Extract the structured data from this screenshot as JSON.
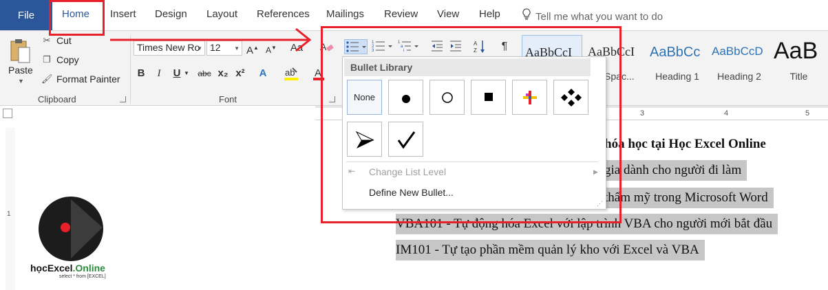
{
  "tabs": [
    {
      "label": "File"
    },
    {
      "label": "Home"
    },
    {
      "label": "Insert"
    },
    {
      "label": "Design"
    },
    {
      "label": "Layout"
    },
    {
      "label": "References"
    },
    {
      "label": "Mailings"
    },
    {
      "label": "Review"
    },
    {
      "label": "View"
    },
    {
      "label": "Help"
    }
  ],
  "tell_me": {
    "text": "Tell me what you want to do",
    "icon": "lightbulb-icon"
  },
  "clipboard": {
    "paste_label": "Paste",
    "cut_label": "Cut",
    "copy_label": "Copy",
    "format_painter_label": "Format Painter",
    "group_label": "Clipboard"
  },
  "font": {
    "family": "Times New Ro",
    "size": "12",
    "grow_label": "A",
    "shrink_label": "A",
    "case_label": "Aa",
    "bold_label": "B",
    "italic_label": "I",
    "underline_label": "U",
    "strike_label": "abc",
    "subscript_label": "x₂",
    "superscript_label": "x²",
    "group_label": "Font"
  },
  "styles": [
    {
      "sample": "AaBbCcI",
      "name": ""
    },
    {
      "sample": "AaBbCcI",
      "name": "o Spac..."
    },
    {
      "sample": "AaBbCc",
      "name": "Heading 1"
    },
    {
      "sample": "AaBbCcD",
      "name": "Heading 2"
    },
    {
      "sample": "AaB",
      "name": "Title"
    }
  ],
  "ruler": {
    "marks": [
      "3",
      "4",
      "5"
    ],
    "vertical_mark": "1"
  },
  "bullet_menu": {
    "title": "Bullet Library",
    "none_label": "None",
    "items": [
      {
        "name": "filled-circle"
      },
      {
        "name": "hollow-circle"
      },
      {
        "name": "filled-square"
      },
      {
        "name": "four-color-cross"
      },
      {
        "name": "four-diamonds"
      },
      {
        "name": "arrowhead"
      },
      {
        "name": "checkmark"
      }
    ],
    "change_level_label": "Change List Level",
    "define_new_label": "Define New Bullet..."
  },
  "document": {
    "lines": [
      "hóa học tại Học Excel Online",
      "gia dành cho người đi làm",
      "thẩm mỹ trong Microsoft Word",
      "VBA101 - Tự động hóa Excel với lập trình VBA cho người mới bắt đầu",
      "IM101 - Tự tạo phần mềm quản lý kho với Excel và VBA"
    ]
  },
  "logo": {
    "text_left": "họcExcel",
    "text_right": ".Online",
    "subtitle": "select * from [EXCEL]"
  },
  "colors": {
    "word_blue": "#2b579a",
    "annotation_red": "#e8202a",
    "selection_gray": "#c6c6c6"
  }
}
